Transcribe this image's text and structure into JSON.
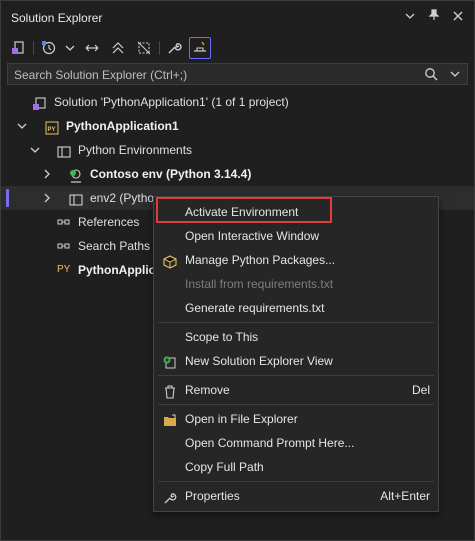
{
  "window": {
    "title": "Solution Explorer"
  },
  "search": {
    "placeholder": "Search Solution Explorer (Ctrl+;)"
  },
  "tree": {
    "solution": "Solution 'PythonApplication1' (1 of 1 project)",
    "project": "PythonApplication1",
    "environments": "Python Environments",
    "contoso": "Contoso env (Python 3.14.4)",
    "env2": "env2 (Pytho",
    "references": "References",
    "search_paths": "Search Paths",
    "py_file": "PythonApplica",
    "py_badge": "PY"
  },
  "context_menu": {
    "activate": "Activate Environment",
    "interactive": "Open Interactive Window",
    "manage": "Manage Python Packages...",
    "install": "Install from requirements.txt",
    "generate": "Generate requirements.txt",
    "scope": "Scope to This",
    "new_view": "New Solution Explorer View",
    "remove": "Remove",
    "remove_shortcut": "Del",
    "file_explorer": "Open in File Explorer",
    "cmd": "Open Command Prompt Here...",
    "copy_path": "Copy Full Path",
    "properties": "Properties",
    "properties_shortcut": "Alt+Enter"
  },
  "colors": {
    "accent": "#7a6cf2",
    "highlight_border": "#e03c3c",
    "background": "#1f1f1f"
  }
}
